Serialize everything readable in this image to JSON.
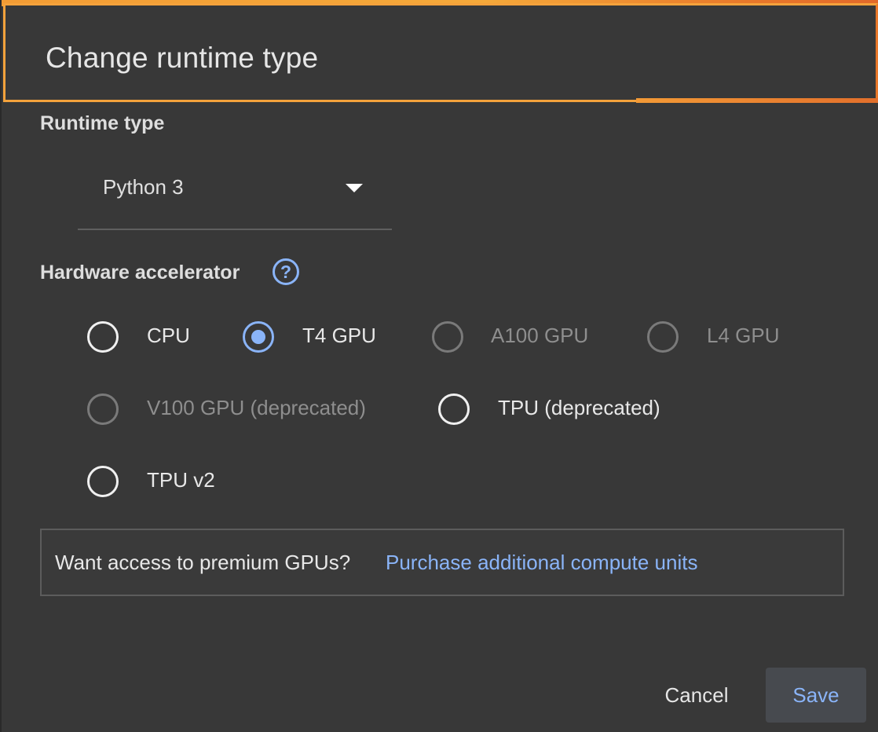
{
  "dialog": {
    "title": "Change runtime type"
  },
  "runtime_type": {
    "label": "Runtime type",
    "selected": "Python 3"
  },
  "hardware_accelerator": {
    "label": "Hardware accelerator",
    "help_icon": "help-circle-icon",
    "help_glyph": "?",
    "options": [
      {
        "label": "CPU",
        "checked": false,
        "disabled": false
      },
      {
        "label": "T4 GPU",
        "checked": true,
        "disabled": false
      },
      {
        "label": "A100 GPU",
        "checked": false,
        "disabled": true
      },
      {
        "label": "L4 GPU",
        "checked": false,
        "disabled": true
      },
      {
        "label": "V100 GPU (deprecated)",
        "checked": false,
        "disabled": true
      },
      {
        "label": "TPU (deprecated)",
        "checked": false,
        "disabled": false
      },
      {
        "label": "TPU v2",
        "checked": false,
        "disabled": false
      }
    ]
  },
  "premium": {
    "text": "Want access to premium GPUs?",
    "link": "Purchase additional compute units"
  },
  "actions": {
    "cancel_label": "Cancel",
    "save_label": "Save"
  },
  "colors": {
    "accent": "#8ab4f8",
    "background": "#383838",
    "highlight": "#f4a23c"
  }
}
